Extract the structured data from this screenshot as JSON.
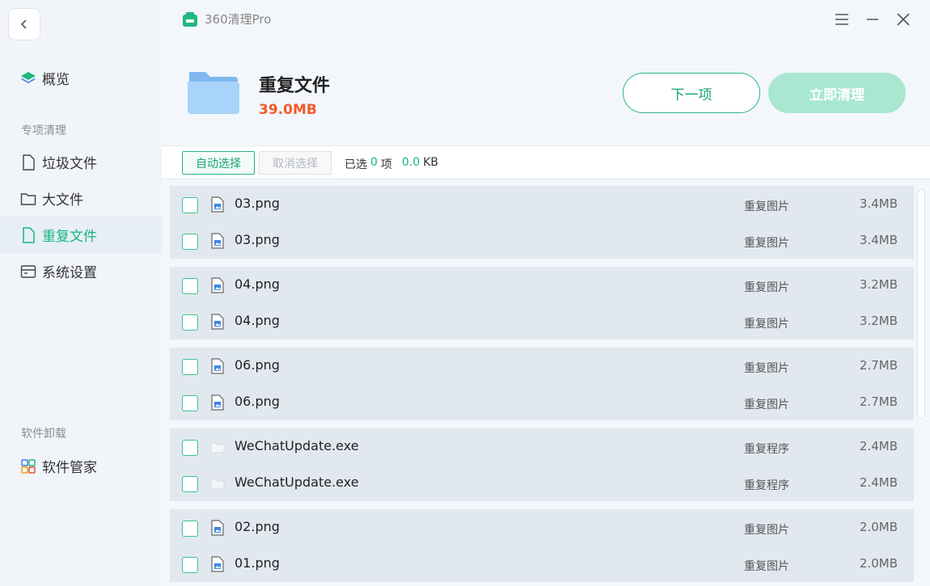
{
  "app": {
    "title": "360清理Pro"
  },
  "sidebar": {
    "overview": "概览",
    "section_special": "专项清理",
    "items": [
      {
        "label": "垃圾文件",
        "icon": "file-icon"
      },
      {
        "label": "大文件",
        "icon": "folder-icon"
      },
      {
        "label": "重复文件",
        "icon": "duplicate-file-icon"
      },
      {
        "label": "系统设置",
        "icon": "settings-window-icon"
      }
    ],
    "active_index": 2,
    "section_uninstall": "软件卸载",
    "software_manager": "软件管家"
  },
  "header": {
    "title": "重复文件",
    "size": "39.0MB",
    "next_label": "下一项",
    "clean_label": "立即清理"
  },
  "toolbar": {
    "auto_select": "自动选择",
    "cancel_select": "取消选择",
    "selected_prefix": "已选",
    "selected_count": "0",
    "selected_unit": "项",
    "selected_size": "0.0",
    "size_unit": "KB"
  },
  "groups": [
    {
      "rows": [
        {
          "name": "03.png",
          "type": "重复图片",
          "size": "3.4MB",
          "kind": "image"
        },
        {
          "name": "03.png",
          "type": "重复图片",
          "size": "3.4MB",
          "kind": "image"
        }
      ]
    },
    {
      "rows": [
        {
          "name": "04.png",
          "type": "重复图片",
          "size": "3.2MB",
          "kind": "image"
        },
        {
          "name": "04.png",
          "type": "重复图片",
          "size": "3.2MB",
          "kind": "image"
        }
      ]
    },
    {
      "rows": [
        {
          "name": "06.png",
          "type": "重复图片",
          "size": "2.7MB",
          "kind": "image"
        },
        {
          "name": "06.png",
          "type": "重复图片",
          "size": "2.7MB",
          "kind": "image"
        }
      ]
    },
    {
      "rows": [
        {
          "name": "WeChatUpdate.exe",
          "type": "重复程序",
          "size": "2.4MB",
          "kind": "exe"
        },
        {
          "name": "WeChatUpdate.exe",
          "type": "重复程序",
          "size": "2.4MB",
          "kind": "exe"
        }
      ]
    },
    {
      "rows": [
        {
          "name": "02.png",
          "type": "重复图片",
          "size": "2.0MB",
          "kind": "image"
        },
        {
          "name": "01.png",
          "type": "重复图片",
          "size": "2.0MB",
          "kind": "image"
        }
      ]
    }
  ],
  "colors": {
    "accent": "#17b580",
    "size_highlight": "#f05a28",
    "clean_button": "#a9e7d1"
  }
}
